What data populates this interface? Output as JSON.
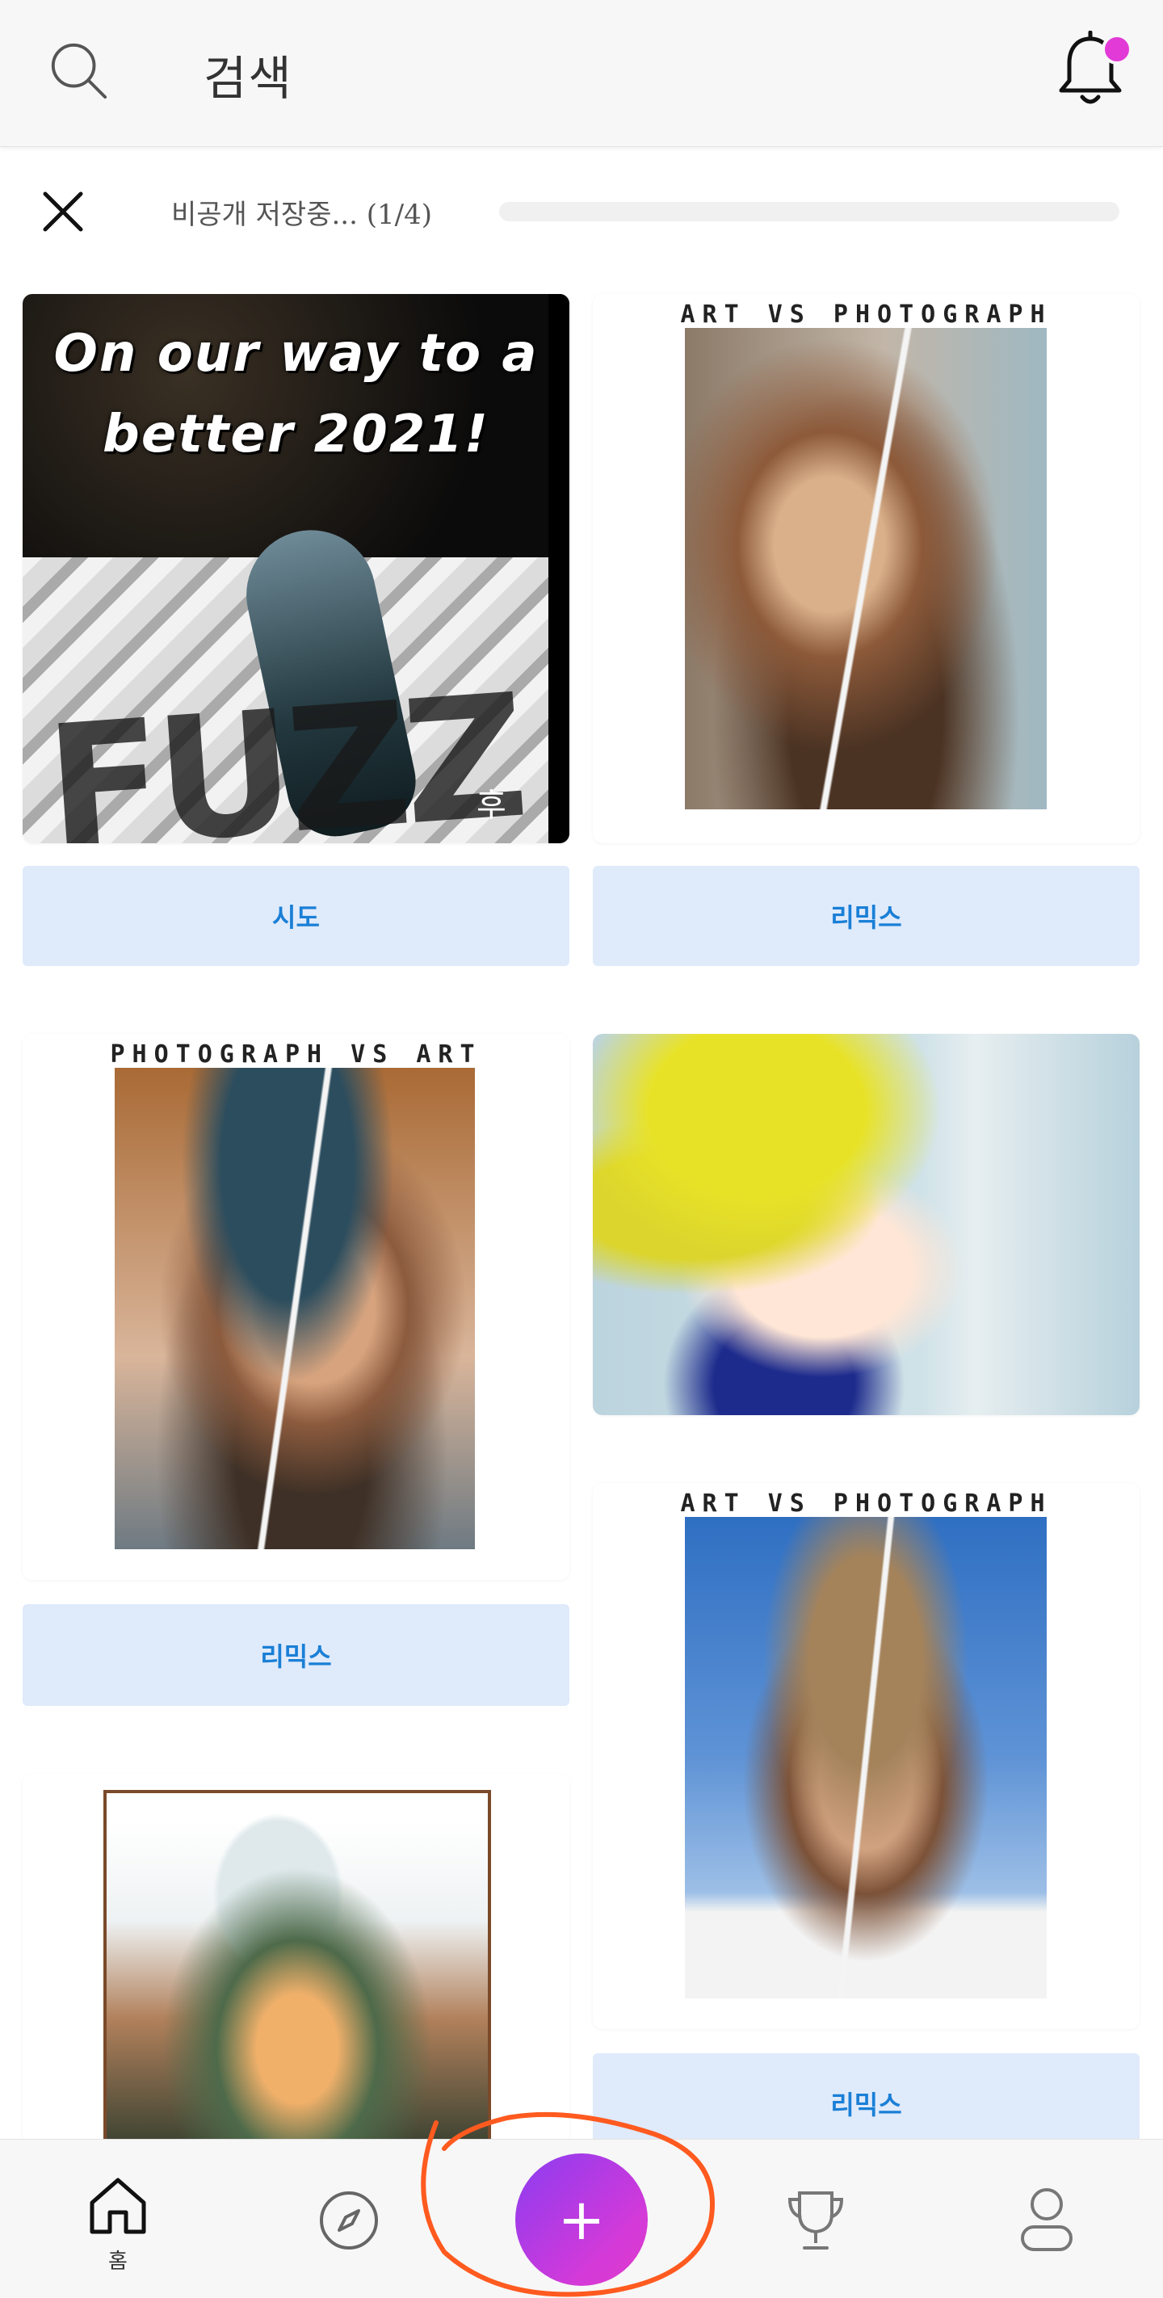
{
  "header": {
    "search_label": "검색",
    "search_icon": "search-icon",
    "bell_icon": "bell-icon",
    "notification_dot_color": "#e23ad6"
  },
  "upload_status": {
    "text": "비공개 저장중... (1/4)",
    "current": 1,
    "total": 4,
    "progress": 0
  },
  "feed": {
    "cards": [
      {
        "caption": "",
        "poster_text": "On our way to a better 2021!",
        "poster_fuzz": "FUZZ",
        "poster_mark": "후",
        "button": "시도"
      },
      {
        "caption": "ART VS PHOTOGRAPH",
        "button": "리믹스"
      },
      {
        "caption": "PHOTOGRAPH VS ART",
        "button": "리믹스"
      },
      {
        "caption": ""
      },
      {
        "caption": "ART VS PHOTOGRAPH",
        "button": "리믹스"
      },
      {
        "caption": ""
      }
    ]
  },
  "nav": {
    "home_label": "홈",
    "add_symbol": "+",
    "icons": [
      "home-icon",
      "compass-icon",
      "plus-icon",
      "trophy-icon",
      "profile-icon"
    ],
    "fab_gradient": [
      "#8b3cf0",
      "#e23acb"
    ],
    "annotation_color": "#ff5a1f"
  }
}
